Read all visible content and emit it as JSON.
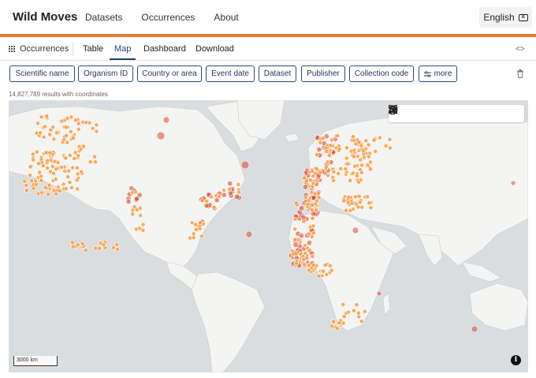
{
  "app": {
    "brand": "Wild Moves",
    "nav": [
      "Datasets",
      "Occurrences",
      "About"
    ],
    "language": "English",
    "accent_color": "#e87a2a"
  },
  "tabs": {
    "section": "Occurrences",
    "items": [
      "Table",
      "Map",
      "Dashboard",
      "Download"
    ],
    "active": "Map"
  },
  "filters": [
    "Scientific name",
    "Organism ID",
    "Country or area",
    "Event date",
    "Dataset",
    "Publisher",
    "Collection code",
    "more"
  ],
  "results_text": "14,827,789 results with coordinates",
  "map": {
    "scale_label": "3000 km",
    "info_label": "i",
    "tools": [
      "zoom-in-icon",
      "zoom-out-icon",
      "fullscreen-icon",
      "draw-polygon-icon",
      "magic-select-icon",
      "delete-icon",
      "layers-icon"
    ],
    "point_color": "#f7a24b",
    "dense_color": "#d93a1e",
    "land_color": "#f4f4f2",
    "water_color": "#d9dddf"
  }
}
